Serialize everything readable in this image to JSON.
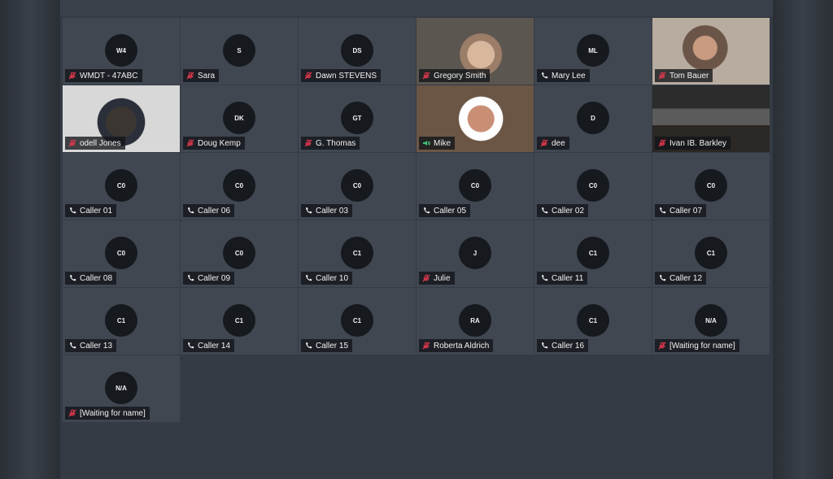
{
  "participants": [
    {
      "initials": "W4",
      "name": "WMDT - 47ABC",
      "status": "muted",
      "video": false
    },
    {
      "initials": "S",
      "name": "Sara",
      "status": "muted",
      "video": false
    },
    {
      "initials": "DS",
      "name": "Dawn STEVENS",
      "status": "muted",
      "video": false
    },
    {
      "initials": "",
      "name": "Gregory Smith",
      "status": "muted",
      "video": true
    },
    {
      "initials": "ML",
      "name": "Mary Lee",
      "status": "phone",
      "video": false
    },
    {
      "initials": "",
      "name": "Tom Bauer",
      "status": "muted",
      "video": true
    },
    {
      "initials": "",
      "name": "odell Jones",
      "status": "muted",
      "video": true
    },
    {
      "initials": "DK",
      "name": "Doug Kemp",
      "status": "muted",
      "video": false
    },
    {
      "initials": "GT",
      "name": "G. Thomas",
      "status": "muted",
      "video": false
    },
    {
      "initials": "",
      "name": "Mike",
      "status": "speaking",
      "video": true
    },
    {
      "initials": "D",
      "name": "dee",
      "status": "muted",
      "video": false
    },
    {
      "initials": "",
      "name": "Ivan IB. Barkley",
      "status": "muted",
      "video": true
    },
    {
      "initials": "C0",
      "name": "Caller 01",
      "status": "phone",
      "video": false
    },
    {
      "initials": "C0",
      "name": "Caller 06",
      "status": "phone",
      "video": false
    },
    {
      "initials": "C0",
      "name": "Caller 03",
      "status": "phone",
      "video": false
    },
    {
      "initials": "C0",
      "name": "Caller 05",
      "status": "phone",
      "video": false
    },
    {
      "initials": "C0",
      "name": "Caller 02",
      "status": "phone",
      "video": false
    },
    {
      "initials": "C0",
      "name": "Caller 07",
      "status": "phone",
      "video": false
    },
    {
      "initials": "C0",
      "name": "Caller 08",
      "status": "phone",
      "video": false
    },
    {
      "initials": "C0",
      "name": "Caller 09",
      "status": "phone",
      "video": false
    },
    {
      "initials": "C1",
      "name": "Caller 10",
      "status": "phone",
      "video": false
    },
    {
      "initials": "J",
      "name": "Julie",
      "status": "muted",
      "video": false
    },
    {
      "initials": "C1",
      "name": "Caller 11",
      "status": "phone",
      "video": false
    },
    {
      "initials": "C1",
      "name": "Caller 12",
      "status": "phone",
      "video": false
    },
    {
      "initials": "C1",
      "name": "Caller 13",
      "status": "phone",
      "video": false
    },
    {
      "initials": "C1",
      "name": "Caller 14",
      "status": "phone",
      "video": false
    },
    {
      "initials": "C1",
      "name": "Caller 15",
      "status": "phone",
      "video": false
    },
    {
      "initials": "RA",
      "name": "Roberta Aldrich",
      "status": "muted",
      "video": false
    },
    {
      "initials": "C1",
      "name": "Caller 16",
      "status": "phone",
      "video": false
    },
    {
      "initials": "N/A",
      "name": "[Waiting for name]",
      "status": "muted",
      "video": false
    },
    {
      "initials": "N/A",
      "name": "[Waiting for name]",
      "status": "muted",
      "video": false
    }
  ],
  "icons": {
    "muted": "muted-mic-icon",
    "phone": "phone-icon",
    "speaking": "speaker-icon"
  },
  "colors": {
    "muted": "#e0384e",
    "phone": "#f0f0f0",
    "speaking": "#3fc27a"
  }
}
